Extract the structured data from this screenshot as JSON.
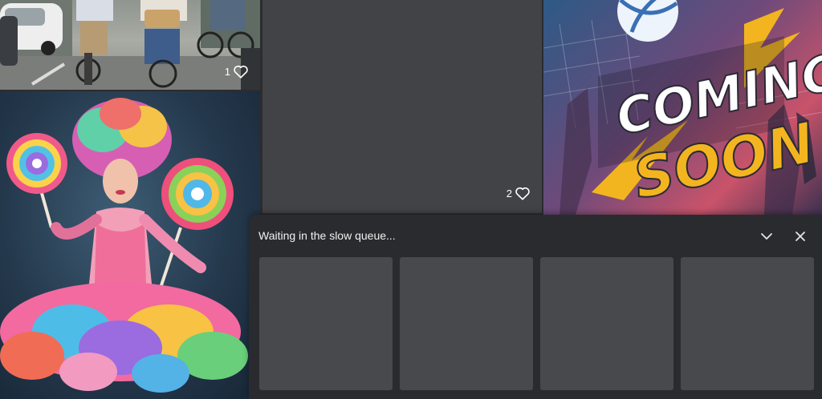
{
  "gallery": {
    "tiles": [
      {
        "name": "street-cyclists",
        "likes": "1"
      },
      {
        "name": "candy-lollipop-woman",
        "likes": ""
      },
      {
        "name": "loading-placeholder",
        "likes": "2"
      },
      {
        "name": "coming-soon-volleyball",
        "likes": ""
      }
    ],
    "poster_text": {
      "line1": "COMING",
      "line2": "SOON"
    }
  },
  "queue": {
    "title": "Waiting in the slow queue...",
    "collapse_icon": "chevron-down-icon",
    "close_icon": "close-icon",
    "slot_count": 4
  },
  "colors": {
    "panel_bg": "#2a2b2f",
    "slot_bg": "#48494c",
    "tile_placeholder": "#424347",
    "poster_accent": "#f3b51f"
  }
}
